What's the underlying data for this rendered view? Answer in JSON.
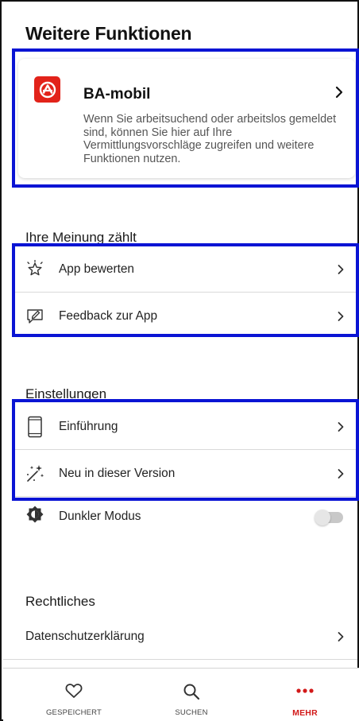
{
  "header": {
    "title": "Weitere Funktionen"
  },
  "ba_card": {
    "title": "BA-mobil",
    "description": "Wenn Sie arbeitsuchend oder arbeitslos gemeldet sind, können Sie hier auf Ihre Vermittlungsvorschläge zugreifen und weitere Funktionen nutzen.",
    "logo_icon": "ba-logo-icon",
    "chevron_icon": "chevron-right-icon"
  },
  "feedback_section": {
    "heading": "Ihre Meinung zählt",
    "items": [
      {
        "label": "App bewerten",
        "icon": "star-sparkle-icon"
      },
      {
        "label": "Feedback zur App",
        "icon": "feedback-edit-icon"
      }
    ]
  },
  "settings_section": {
    "heading": "Einstellungen",
    "items": [
      {
        "label": "Einführung",
        "icon": "phone-icon"
      },
      {
        "label": "Neu in dieser Version",
        "icon": "sparkles-icon"
      },
      {
        "label": "Dunkler Modus",
        "icon": "dark-mode-icon",
        "toggle_on": false
      }
    ]
  },
  "legal_section": {
    "heading": "Rechtliches",
    "items": [
      {
        "label": "Datenschutzerklärung",
        "icon": "chevron-right-icon"
      }
    ]
  },
  "bottom_nav": {
    "items": [
      {
        "label": "GESPEICHERT",
        "icon": "heart-icon",
        "active": false
      },
      {
        "label": "SUCHEN",
        "icon": "search-icon",
        "active": false
      },
      {
        "label": "MEHR",
        "icon": "more-dots-icon",
        "active": true
      }
    ]
  },
  "colors": {
    "accent": "#d21a1a",
    "ba_red": "#e2231a",
    "highlight_border": "#0a14d4"
  }
}
